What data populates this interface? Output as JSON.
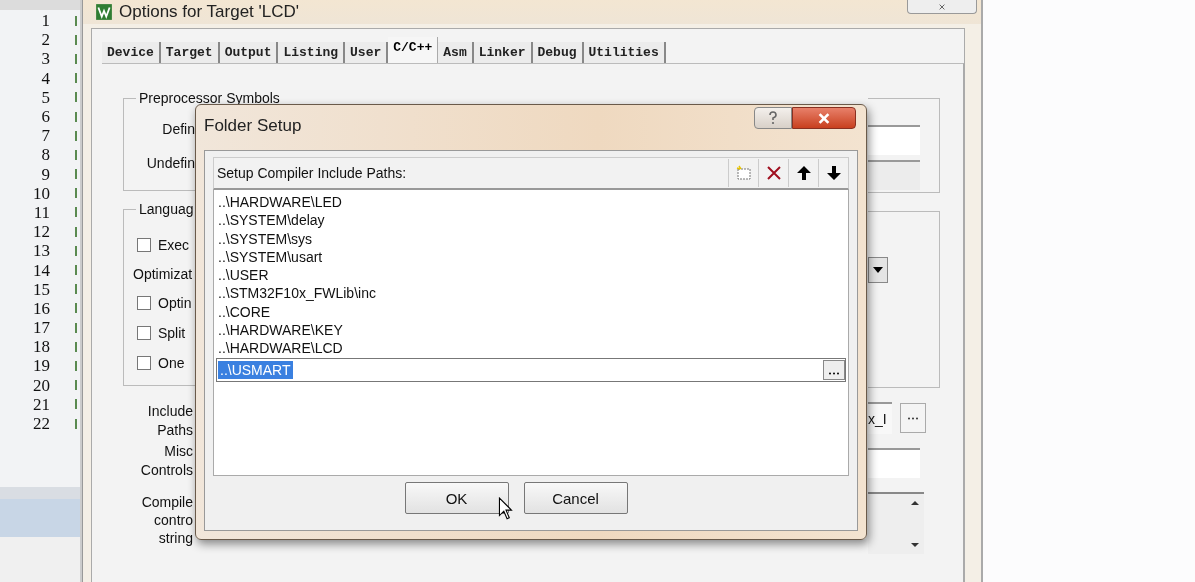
{
  "editor": {
    "line_numbers": [
      "1",
      "2",
      "3",
      "4",
      "5",
      "6",
      "7",
      "8",
      "9",
      "10",
      "11",
      "12",
      "13",
      "14",
      "15",
      "16",
      "17",
      "18",
      "19",
      "20",
      "21",
      "22"
    ]
  },
  "options_window": {
    "title": "Options for Target 'LCD'",
    "tabs": [
      {
        "label": "Device",
        "selected": false
      },
      {
        "label": "Target",
        "selected": false
      },
      {
        "label": "Output",
        "selected": false
      },
      {
        "label": "Listing",
        "selected": false
      },
      {
        "label": "User",
        "selected": false
      },
      {
        "label": "C/C++",
        "selected": true
      },
      {
        "label": "Asm",
        "selected": false
      },
      {
        "label": "Linker",
        "selected": false
      },
      {
        "label": "Debug",
        "selected": false
      },
      {
        "label": "Utilities",
        "selected": false
      }
    ],
    "preprocessor": {
      "title": "Preprocessor Symbols",
      "labels": [
        "Defin",
        "Undefin"
      ]
    },
    "language": {
      "title": "Languag",
      "options": [
        {
          "kind": "checkbox",
          "label": "Exec",
          "checked": false
        },
        {
          "kind": "label",
          "label": "Optimizat"
        },
        {
          "kind": "checkbox",
          "label": "Optin",
          "checked": false
        },
        {
          "kind": "checkbox",
          "label": "Split",
          "checked": false
        },
        {
          "kind": "checkbox",
          "label": "One",
          "checked": false
        }
      ]
    },
    "fields": [
      {
        "kind": "browse",
        "label_lines": [
          "Include",
          "Paths"
        ],
        "value": "x_I"
      },
      {
        "kind": "text",
        "label_lines": [
          "Misc",
          "Controls"
        ]
      },
      {
        "kind": "textarea",
        "label_lines": [
          "Compile",
          "contro",
          "string"
        ]
      }
    ]
  },
  "folder_setup": {
    "title": "Folder Setup",
    "header": "Setup Compiler Include Paths:",
    "paths": [
      {
        "text": "..\\HARDWARE\\LED",
        "selected": false
      },
      {
        "text": "..\\SYSTEM\\delay",
        "selected": false
      },
      {
        "text": "..\\SYSTEM\\sys",
        "selected": false
      },
      {
        "text": "..\\SYSTEM\\usart",
        "selected": false
      },
      {
        "text": "..\\USER",
        "selected": false
      },
      {
        "text": "..\\STM32F10x_FWLib\\inc",
        "selected": false
      },
      {
        "text": "..\\CORE",
        "selected": false
      },
      {
        "text": "..\\HARDWARE\\KEY",
        "selected": false
      },
      {
        "text": "..\\HARDWARE\\LCD",
        "selected": false
      },
      {
        "text": "..\\USMART",
        "selected": true
      }
    ],
    "buttons": [
      "OK",
      "Cancel"
    ]
  }
}
